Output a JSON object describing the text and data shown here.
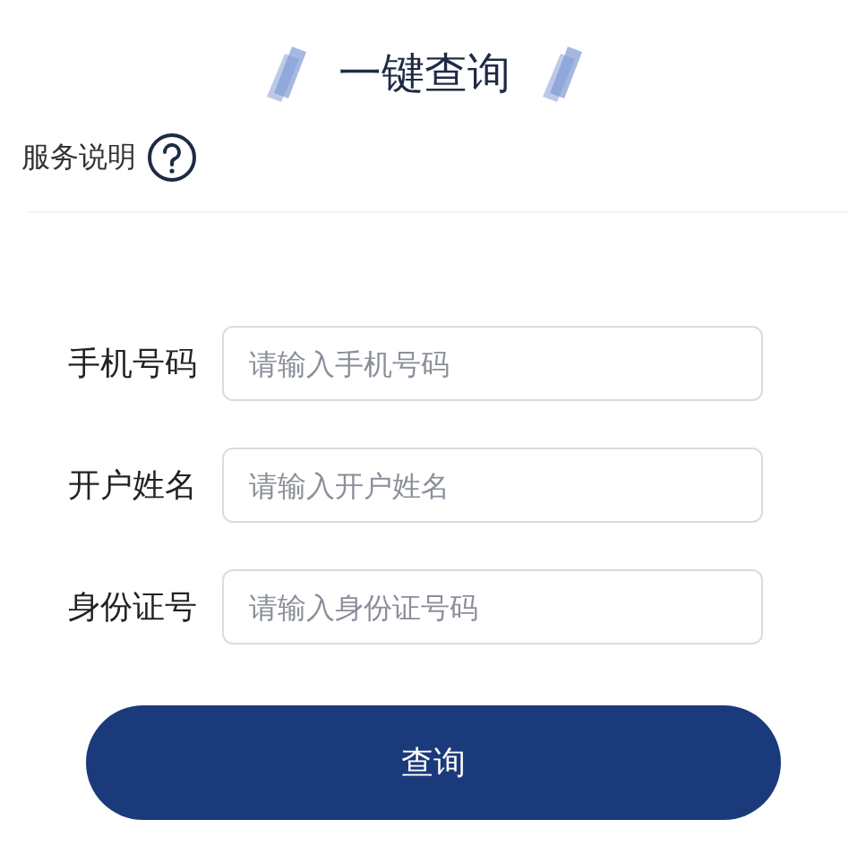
{
  "title": "一键查询",
  "service_note": {
    "label": "服务说明"
  },
  "fields": [
    {
      "label": "手机号码",
      "placeholder": "请输入手机号码"
    },
    {
      "label": "开户姓名",
      "placeholder": "请输入开户姓名"
    },
    {
      "label": "身份证号",
      "placeholder": "请输入身份证号码"
    }
  ],
  "submit_button": "查询"
}
